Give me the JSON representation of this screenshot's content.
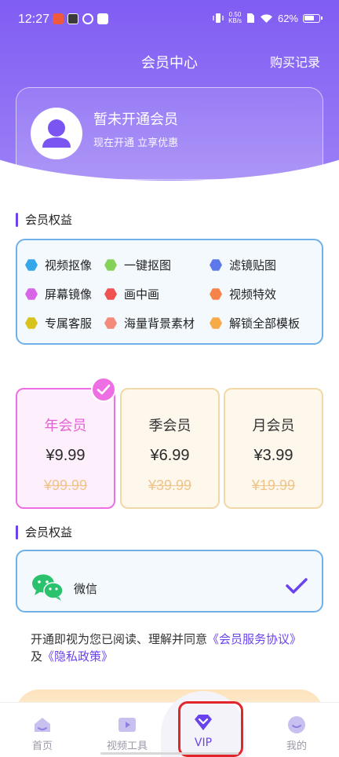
{
  "status_bar": {
    "time": "12:27",
    "net_speed_value": "0.50",
    "net_speed_unit": "KB/s",
    "battery": "62%"
  },
  "header": {
    "title": "会员中心",
    "purchase_link": "购买记录"
  },
  "member_card": {
    "title": "暂未开通会员",
    "subtitle": "现在开通 立享优惠"
  },
  "benefits_section": {
    "title": "会员权益",
    "items": [
      {
        "label": "视频抠像",
        "color": "#35a6e8"
      },
      {
        "label": "一键抠图",
        "color": "#84d25a"
      },
      {
        "label": "滤镜贴图",
        "color": "#5d78e8"
      },
      {
        "label": "屏幕镜像",
        "color": "#d666e6"
      },
      {
        "label": "画中画",
        "color": "#ef5250"
      },
      {
        "label": "视频特效",
        "color": "#f6844a"
      },
      {
        "label": "专属客服",
        "color": "#d8c21c"
      },
      {
        "label": "海量背景素材",
        "color": "#f48a7a"
      },
      {
        "label": "解锁全部模板",
        "color": "#f7ab48"
      }
    ]
  },
  "plans": [
    {
      "name": "年会员",
      "price": "¥9.99",
      "original": "¥99.99",
      "selected": true
    },
    {
      "name": "季会员",
      "price": "¥6.99",
      "original": "¥39.99",
      "selected": false
    },
    {
      "name": "月会员",
      "price": "¥3.99",
      "original": "¥19.99",
      "selected": false
    }
  ],
  "payment_section": {
    "title": "会员权益",
    "method": "微信"
  },
  "agreement": {
    "prefix": "开通即视为您已阅读、理解并同意",
    "service_link": "《会员服务协议》",
    "connector": "及",
    "privacy_link": "《隐私政策》"
  },
  "bottom_nav": [
    {
      "label": "首页",
      "active": false
    },
    {
      "label": "视频工具",
      "active": false
    },
    {
      "label": "VIP",
      "active": true
    },
    {
      "label": "我的",
      "active": false
    }
  ],
  "colors": {
    "brand_purple": "#6b43ee",
    "selected_plan_pink": "#ee6fe4",
    "benefit_border": "#6fb0e8",
    "highlight_red": "#e0262c"
  }
}
